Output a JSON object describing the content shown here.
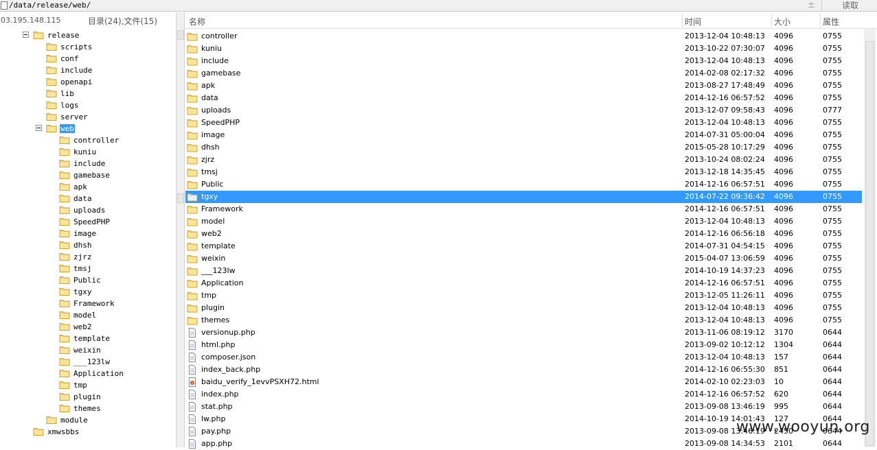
{
  "pathbar": {
    "path": "/data/release/web/",
    "plusminus": "±",
    "read_label": "读取"
  },
  "left_panel": {
    "host": "03.195.148.115",
    "counts": "目录(24),文件(15)",
    "tree": [
      {
        "label": "release",
        "toggle": true
      },
      {
        "label": "scripts"
      },
      {
        "label": "conf"
      },
      {
        "label": "include"
      },
      {
        "label": "openapi"
      },
      {
        "label": "lib"
      },
      {
        "label": "logs"
      },
      {
        "label": "server"
      },
      {
        "label": "web",
        "toggle": true,
        "selected": true
      },
      {
        "label": "controller"
      },
      {
        "label": "kuniu"
      },
      {
        "label": "include"
      },
      {
        "label": "gamebase"
      },
      {
        "label": "apk"
      },
      {
        "label": "data"
      },
      {
        "label": "uploads"
      },
      {
        "label": "SpeedPHP"
      },
      {
        "label": "image"
      },
      {
        "label": "dhsh"
      },
      {
        "label": "zjrz"
      },
      {
        "label": "tmsj"
      },
      {
        "label": "Public"
      },
      {
        "label": "tgxy"
      },
      {
        "label": "Framework"
      },
      {
        "label": "model"
      },
      {
        "label": "web2"
      },
      {
        "label": "template"
      },
      {
        "label": "weixin"
      },
      {
        "label": "___123lw"
      },
      {
        "label": "Application"
      },
      {
        "label": "tmp"
      },
      {
        "label": "plugin"
      },
      {
        "label": "themes"
      },
      {
        "label": "module"
      },
      {
        "label": "xmwsbbs"
      }
    ]
  },
  "file_list": {
    "columns": {
      "name": "名称",
      "time": "时间",
      "size": "大小",
      "perm": "属性"
    },
    "rows": [
      {
        "type": "folder",
        "name": "controller",
        "time": "2013-12-04 10:48:13",
        "size": "4096",
        "perm": "0755"
      },
      {
        "type": "folder",
        "name": "kuniu",
        "time": "2013-10-22 07:30:07",
        "size": "4096",
        "perm": "0755"
      },
      {
        "type": "folder",
        "name": "include",
        "time": "2013-12-04 10:48:13",
        "size": "4096",
        "perm": "0755"
      },
      {
        "type": "folder",
        "name": "gamebase",
        "time": "2014-02-08 02:17:32",
        "size": "4096",
        "perm": "0755"
      },
      {
        "type": "folder",
        "name": "apk",
        "time": "2013-08-27 17:48:49",
        "size": "4096",
        "perm": "0755"
      },
      {
        "type": "folder",
        "name": "data",
        "time": "2014-12-16 06:57:52",
        "size": "4096",
        "perm": "0755"
      },
      {
        "type": "folder",
        "name": "uploads",
        "time": "2013-12-07 09:58:43",
        "size": "4096",
        "perm": "0777"
      },
      {
        "type": "folder",
        "name": "SpeedPHP",
        "time": "2013-12-04 10:48:13",
        "size": "4096",
        "perm": "0755"
      },
      {
        "type": "folder",
        "name": "image",
        "time": "2014-07-31 05:00:04",
        "size": "4096",
        "perm": "0755"
      },
      {
        "type": "folder",
        "name": "dhsh",
        "time": "2015-05-28 10:17:29",
        "size": "4096",
        "perm": "0755"
      },
      {
        "type": "folder",
        "name": "zjrz",
        "time": "2013-10-24 08:02:24",
        "size": "4096",
        "perm": "0755"
      },
      {
        "type": "folder",
        "name": "tmsj",
        "time": "2013-12-18 14:35:45",
        "size": "4096",
        "perm": "0755"
      },
      {
        "type": "folder",
        "name": "Public",
        "time": "2014-12-16 06:57:51",
        "size": "4096",
        "perm": "0755"
      },
      {
        "type": "folder",
        "name": "tgxy",
        "time": "2014-07-22 09:36:42",
        "size": "4096",
        "perm": "0755",
        "selected": true
      },
      {
        "type": "folder",
        "name": "Framework",
        "time": "2014-12-16 06:57:51",
        "size": "4096",
        "perm": "0755"
      },
      {
        "type": "folder",
        "name": "model",
        "time": "2013-12-04 10:48:13",
        "size": "4096",
        "perm": "0755"
      },
      {
        "type": "folder",
        "name": "web2",
        "time": "2014-12-16 06:56:18",
        "size": "4096",
        "perm": "0755"
      },
      {
        "type": "folder",
        "name": "template",
        "time": "2014-07-31 04:54:15",
        "size": "4096",
        "perm": "0755"
      },
      {
        "type": "folder",
        "name": "weixin",
        "time": "2015-04-07 13:06:59",
        "size": "4096",
        "perm": "0755"
      },
      {
        "type": "folder",
        "name": "___123lw",
        "time": "2014-10-19 14:37:23",
        "size": "4096",
        "perm": "0755"
      },
      {
        "type": "folder",
        "name": "Application",
        "time": "2014-12-16 06:57:51",
        "size": "4096",
        "perm": "0755"
      },
      {
        "type": "folder",
        "name": "tmp",
        "time": "2013-12-05 11:26:11",
        "size": "4096",
        "perm": "0755"
      },
      {
        "type": "folder",
        "name": "plugin",
        "time": "2013-12-04 10:48:13",
        "size": "4096",
        "perm": "0755"
      },
      {
        "type": "folder",
        "name": "themes",
        "time": "2013-12-04 10:48:13",
        "size": "4096",
        "perm": "0755"
      },
      {
        "type": "file",
        "name": "versionup.php",
        "time": "2013-11-06 08:19:12",
        "size": "3170",
        "perm": "0644"
      },
      {
        "type": "file",
        "name": "html.php",
        "time": "2013-09-02 10:12:12",
        "size": "1304",
        "perm": "0644"
      },
      {
        "type": "file",
        "name": "composer.json",
        "time": "2013-12-04 10:48:13",
        "size": "157",
        "perm": "0644"
      },
      {
        "type": "file",
        "name": "index_back.php",
        "time": "2014-12-16 06:55:30",
        "size": "851",
        "perm": "0644"
      },
      {
        "type": "html",
        "name": "baidu_verify_1evvPSXH72.html",
        "time": "2014-02-10 02:23:03",
        "size": "10",
        "perm": "0644"
      },
      {
        "type": "file",
        "name": "index.php",
        "time": "2014-12-16 06:57:52",
        "size": "620",
        "perm": "0644"
      },
      {
        "type": "file",
        "name": "stat.php",
        "time": "2013-09-08 13:46:19",
        "size": "995",
        "perm": "0644"
      },
      {
        "type": "file",
        "name": "lw.php",
        "time": "2014-10-19 14:01:43",
        "size": "127",
        "perm": "0644"
      },
      {
        "type": "file",
        "name": "pay.php",
        "time": "2013-09-08 13:46:19",
        "size": "2450",
        "perm": "0644"
      },
      {
        "type": "file",
        "name": "app.php",
        "time": "2013-09-08 14:34:53",
        "size": "2101",
        "perm": "0644"
      }
    ]
  },
  "watermark": "www.wooyun.org",
  "colors": {
    "selection": "#3399ff",
    "folder_fill": "#f6d46b",
    "folder_edge": "#c9a23a"
  }
}
